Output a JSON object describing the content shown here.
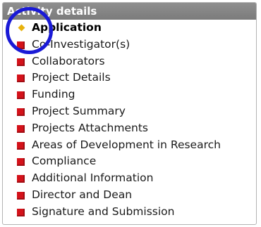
{
  "panel": {
    "title": "Activity details"
  },
  "items": [
    {
      "label": "Application",
      "icon": "yellow-diamond-icon",
      "active": true
    },
    {
      "label": "Co-Investigator(s)",
      "icon": "red-square-icon",
      "active": false
    },
    {
      "label": "Collaborators",
      "icon": "red-square-icon",
      "active": false
    },
    {
      "label": "Project Details",
      "icon": "red-square-icon",
      "active": false
    },
    {
      "label": "Funding",
      "icon": "red-square-icon",
      "active": false
    },
    {
      "label": "Project Summary",
      "icon": "red-square-icon",
      "active": false
    },
    {
      "label": "Projects Attachments",
      "icon": "red-square-icon",
      "active": false
    },
    {
      "label": "Areas of Development in Research",
      "icon": "red-square-icon",
      "active": false
    },
    {
      "label": "Compliance",
      "icon": "red-square-icon",
      "active": false
    },
    {
      "label": "Additional Information",
      "icon": "red-square-icon",
      "active": false
    },
    {
      "label": "Director and Dean",
      "icon": "red-square-icon",
      "active": false
    },
    {
      "label": "Signature and Submission",
      "icon": "red-square-icon",
      "active": false
    }
  ],
  "colors": {
    "header_bg": "#808080",
    "incomplete_marker": "#d4121a",
    "active_marker": "#e8b20c",
    "annotation_circle": "#1a1ad6"
  }
}
